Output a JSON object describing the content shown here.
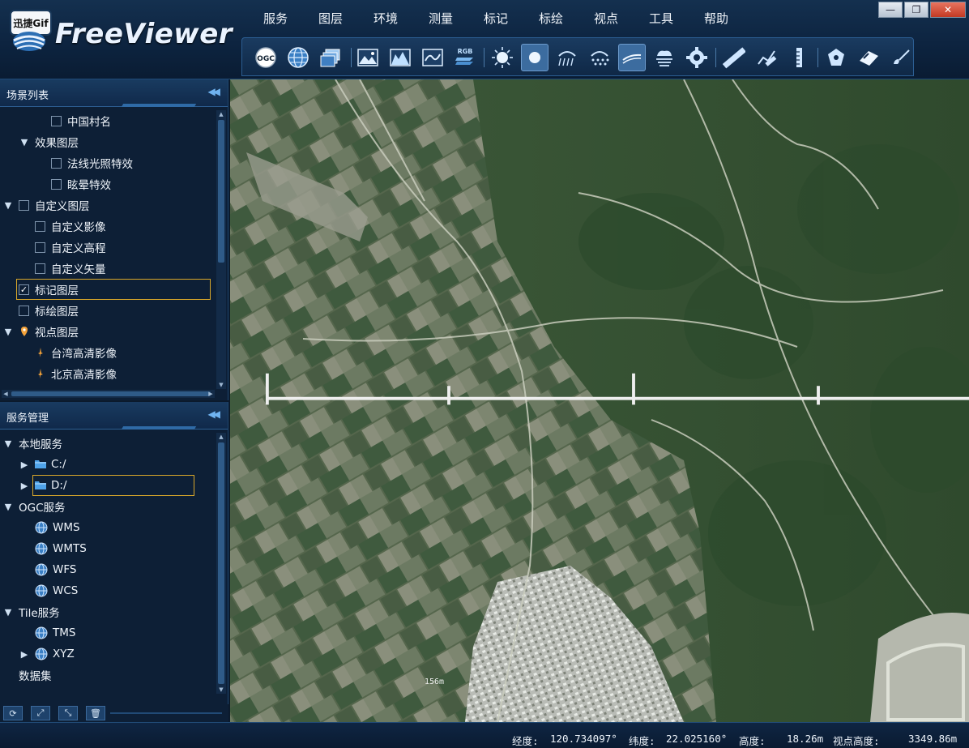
{
  "window": {
    "badge": "迅捷Gif",
    "app_title": "FreeViewer",
    "controls": {
      "minimize": "—",
      "restore": "❐",
      "close": "✕"
    }
  },
  "menu": [
    "服务",
    "图层",
    "环境",
    "测量",
    "标记",
    "标绘",
    "视点",
    "工具",
    "帮助"
  ],
  "toolbar": {
    "icons": [
      "ogc-icon",
      "globe-icon",
      "layers-icon",
      "image-icon",
      "terrain-icon",
      "map-icon",
      "rgb-icon",
      "sun-icon",
      "ball-icon",
      "rain-icon",
      "snow-icon",
      "wind-icon",
      "fog-icon",
      "gear-icon",
      "ruler-icon",
      "path-measure-icon",
      "height-measure-icon",
      "marker-icon",
      "plot-icon",
      "brush-icon"
    ],
    "ogc_label": "OGC",
    "rgb_label": "RGB",
    "active": [
      "ball-icon",
      "wind-icon"
    ]
  },
  "scene_panel": {
    "title": "场景列表",
    "collapse": "◀◀",
    "items": [
      {
        "label": "中国村名",
        "checked": false
      },
      {
        "label": "效果图层",
        "expanded": true
      },
      {
        "label": "法线光照特效",
        "checked": false
      },
      {
        "label": "眩晕特效",
        "checked": false
      },
      {
        "label": "自定义图层",
        "checked": false,
        "expanded": true
      },
      {
        "label": "自定义影像",
        "checked": false
      },
      {
        "label": "自定义高程",
        "checked": false
      },
      {
        "label": "自定义矢量",
        "checked": false
      },
      {
        "label": "标记图层",
        "checked": true,
        "selected": true
      },
      {
        "label": "标绘图层",
        "checked": false
      },
      {
        "label": "视点图层",
        "expanded": true
      },
      {
        "label": "台湾高清影像"
      },
      {
        "label": "北京高清影像"
      }
    ]
  },
  "service_panel": {
    "title": "服务管理",
    "collapse": "◀◀",
    "items": [
      {
        "label": "本地服务",
        "expanded": true
      },
      {
        "label": "C:/"
      },
      {
        "label": "D:/",
        "selected": true
      },
      {
        "label": "OGC服务",
        "expanded": true
      },
      {
        "label": "WMS"
      },
      {
        "label": "WMTS"
      },
      {
        "label": "WFS"
      },
      {
        "label": "WCS"
      },
      {
        "label": "Tile服务",
        "expanded": true
      },
      {
        "label": "TMS"
      },
      {
        "label": "XYZ"
      },
      {
        "label": "数据集"
      }
    ]
  },
  "footer_buttons": [
    "refresh-icon",
    "expand-icon",
    "collapse-icon",
    "delete-icon"
  ],
  "map": {
    "scale_label": "156m"
  },
  "status": {
    "lon_label": "经度:",
    "lon_value": "120.734097°",
    "lat_label": "纬度:",
    "lat_value": "22.025160°",
    "alt_label": "高度:",
    "alt_value": "18.26m",
    "view_label": "视点高度:",
    "view_value": "3349.86m"
  },
  "colors": {
    "accent": "#2f6aa6",
    "selection": "#d8a72a",
    "panel_bg": "#0d1f36"
  }
}
